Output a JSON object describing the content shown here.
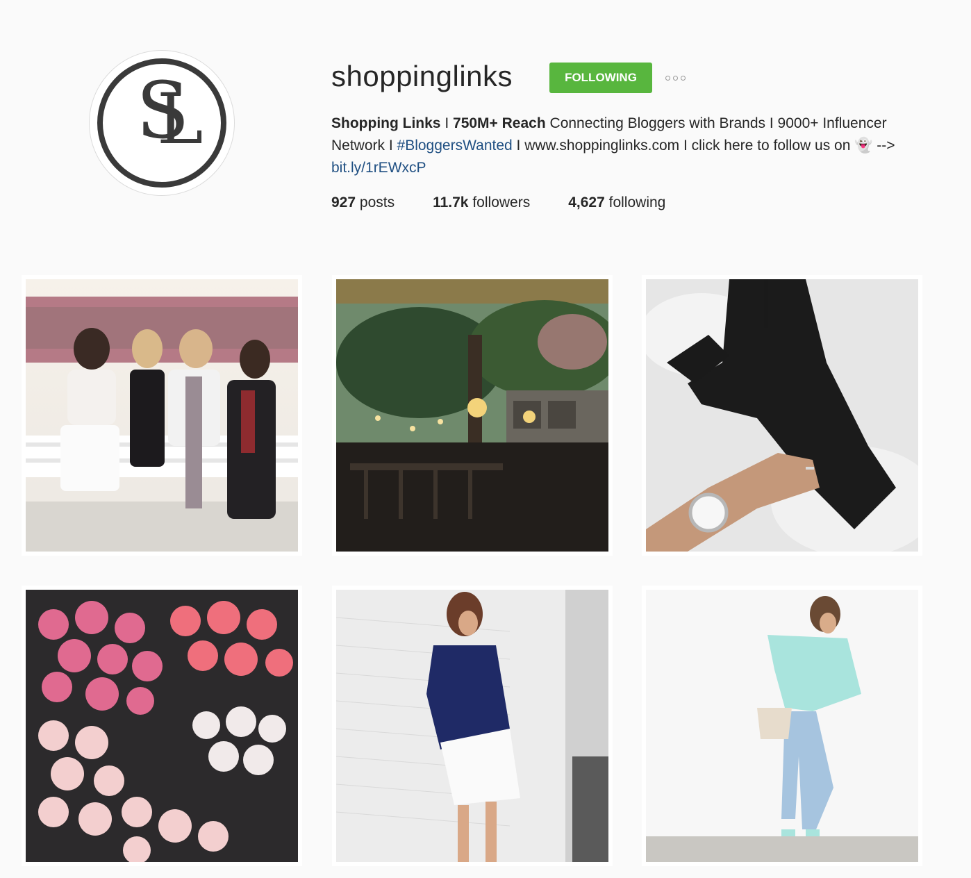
{
  "profile": {
    "avatar_letters": [
      "S",
      "L"
    ],
    "username": "shoppinglinks",
    "follow_button": "FOLLOWING",
    "more_icon": "ellipsis-icon",
    "bio": {
      "name": "Shopping Links",
      "sep1": " I ",
      "reach": "750M+ Reach",
      "line1_rest": " Connecting Bloggers with Brands I 9000+ Influencer Network I ",
      "hashtag": "#BloggersWanted",
      "line2_rest": " I www.shoppinglinks.com I click here to follow us on ",
      "emoji": "👻",
      "arrow": " --> ",
      "link": "bit.ly/1rEWxcP"
    },
    "stats": {
      "posts_count": "927",
      "posts_label": "posts",
      "followers_count": "11.7k",
      "followers_label": "followers",
      "following_count": "4,627",
      "following_label": "following"
    }
  },
  "grid": {
    "posts": [
      {
        "subject": "four-women-festival-photo"
      },
      {
        "subject": "restaurant-patio-chandelier-photo"
      },
      {
        "subject": "black-lace-up-heels-watch-photo"
      },
      {
        "subject": "pink-roses-bouquets-photo"
      },
      {
        "subject": "woman-navy-shirt-white-skirt-photo"
      },
      {
        "subject": "woman-mint-blouse-jeans-photo"
      }
    ]
  },
  "colors": {
    "background": "#fafafa",
    "follow_green": "#58b63e",
    "link_blue": "#1f4f82",
    "text": "#262626"
  }
}
